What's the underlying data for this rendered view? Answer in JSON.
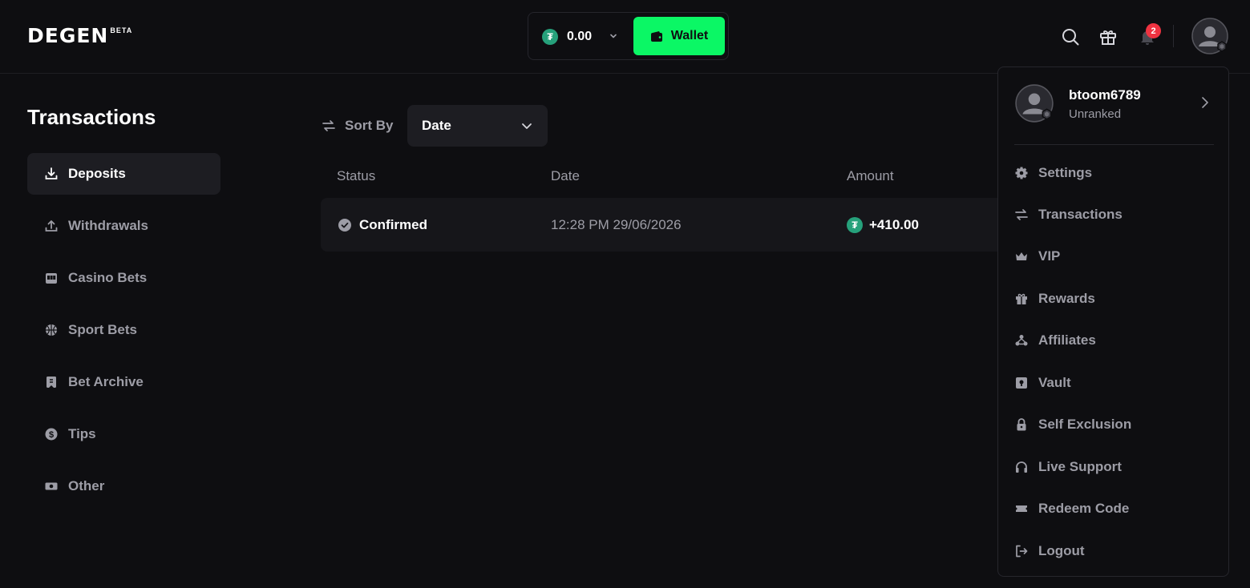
{
  "header": {
    "logo": "DEGEN",
    "logo_tag": "BETA",
    "balance": "0.00",
    "currency_symbol": "₮",
    "wallet_label": "Wallet",
    "notification_count": "2"
  },
  "sidebar": {
    "title": "Transactions",
    "items": [
      {
        "label": "Deposits"
      },
      {
        "label": "Withdrawals"
      },
      {
        "label": "Casino Bets"
      },
      {
        "label": "Sport Bets"
      },
      {
        "label": "Bet Archive"
      },
      {
        "label": "Tips"
      },
      {
        "label": "Other"
      }
    ]
  },
  "main": {
    "sort_label": "Sort By",
    "sort_value": "Date",
    "columns": [
      "Status",
      "Date",
      "Amount"
    ],
    "rows": [
      {
        "status": "Confirmed",
        "date": "12:28 PM 29/06/2026",
        "amount": "+410.00"
      }
    ]
  },
  "menu": {
    "username": "btoom6789",
    "rank": "Unranked",
    "items": [
      {
        "label": "Settings"
      },
      {
        "label": "Transactions"
      },
      {
        "label": "VIP"
      },
      {
        "label": "Rewards"
      },
      {
        "label": "Affiliates"
      },
      {
        "label": "Vault"
      },
      {
        "label": "Self Exclusion"
      },
      {
        "label": "Live Support"
      },
      {
        "label": "Redeem Code"
      },
      {
        "label": "Logout"
      }
    ]
  },
  "colors": {
    "background": "#0e0e11",
    "accent": "#0bf765",
    "usdt": "#26a17b",
    "badge": "#ef3341",
    "muted_text": "#9d9da6"
  }
}
